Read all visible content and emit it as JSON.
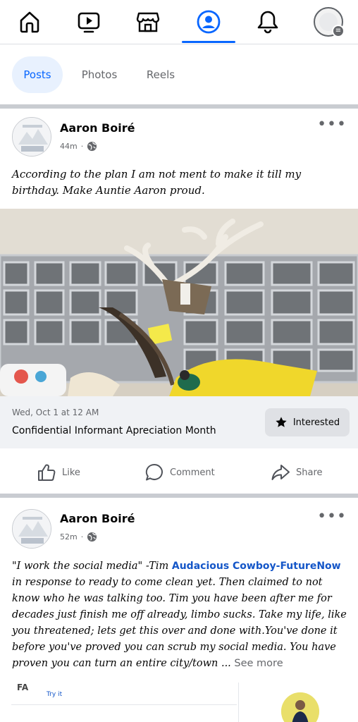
{
  "nav": {
    "items": [
      {
        "name": "home-icon"
      },
      {
        "name": "video-icon"
      },
      {
        "name": "marketplace-icon"
      },
      {
        "name": "profile-icon",
        "active": true
      },
      {
        "name": "bell-icon"
      },
      {
        "name": "menu-avatar-icon"
      }
    ],
    "active_color": "#0866ff"
  },
  "tabs": [
    {
      "label": "Posts",
      "active": true
    },
    {
      "label": "Photos",
      "active": false
    },
    {
      "label": "Reels",
      "active": false
    }
  ],
  "post1": {
    "author": "Aaron Boiré",
    "time": "44m",
    "text": "According to the plan I am not ment to make it till my birthday. Make Auntie Aaron proud.",
    "event": {
      "date": "Wed, Oct 1 at 12 AM",
      "title": "Confidential Informant Apreciation Month",
      "interested_label": "Interested"
    },
    "actions": {
      "like": "Like",
      "comment": "Comment",
      "share": "Share"
    }
  },
  "post2": {
    "author": "Aaron Boiré",
    "time": "52m",
    "text_before": "\"I work the social media\" -Tim ",
    "mention": "Audacious Cowboy-FutureNow",
    "text_after": " in response to ready to come clean yet.  Then claimed to not know who he was talking too. Tim you have been after me for decades just finish me off already, limbo sucks. Take my life, like you threatened; lets get this over and done with.You've done it before you've proved you can scrub my social media. You have proven you can turn an entire city/town ... ",
    "see_more": "See more"
  },
  "preview": {
    "logo": "FA",
    "try_label": "Try it"
  }
}
